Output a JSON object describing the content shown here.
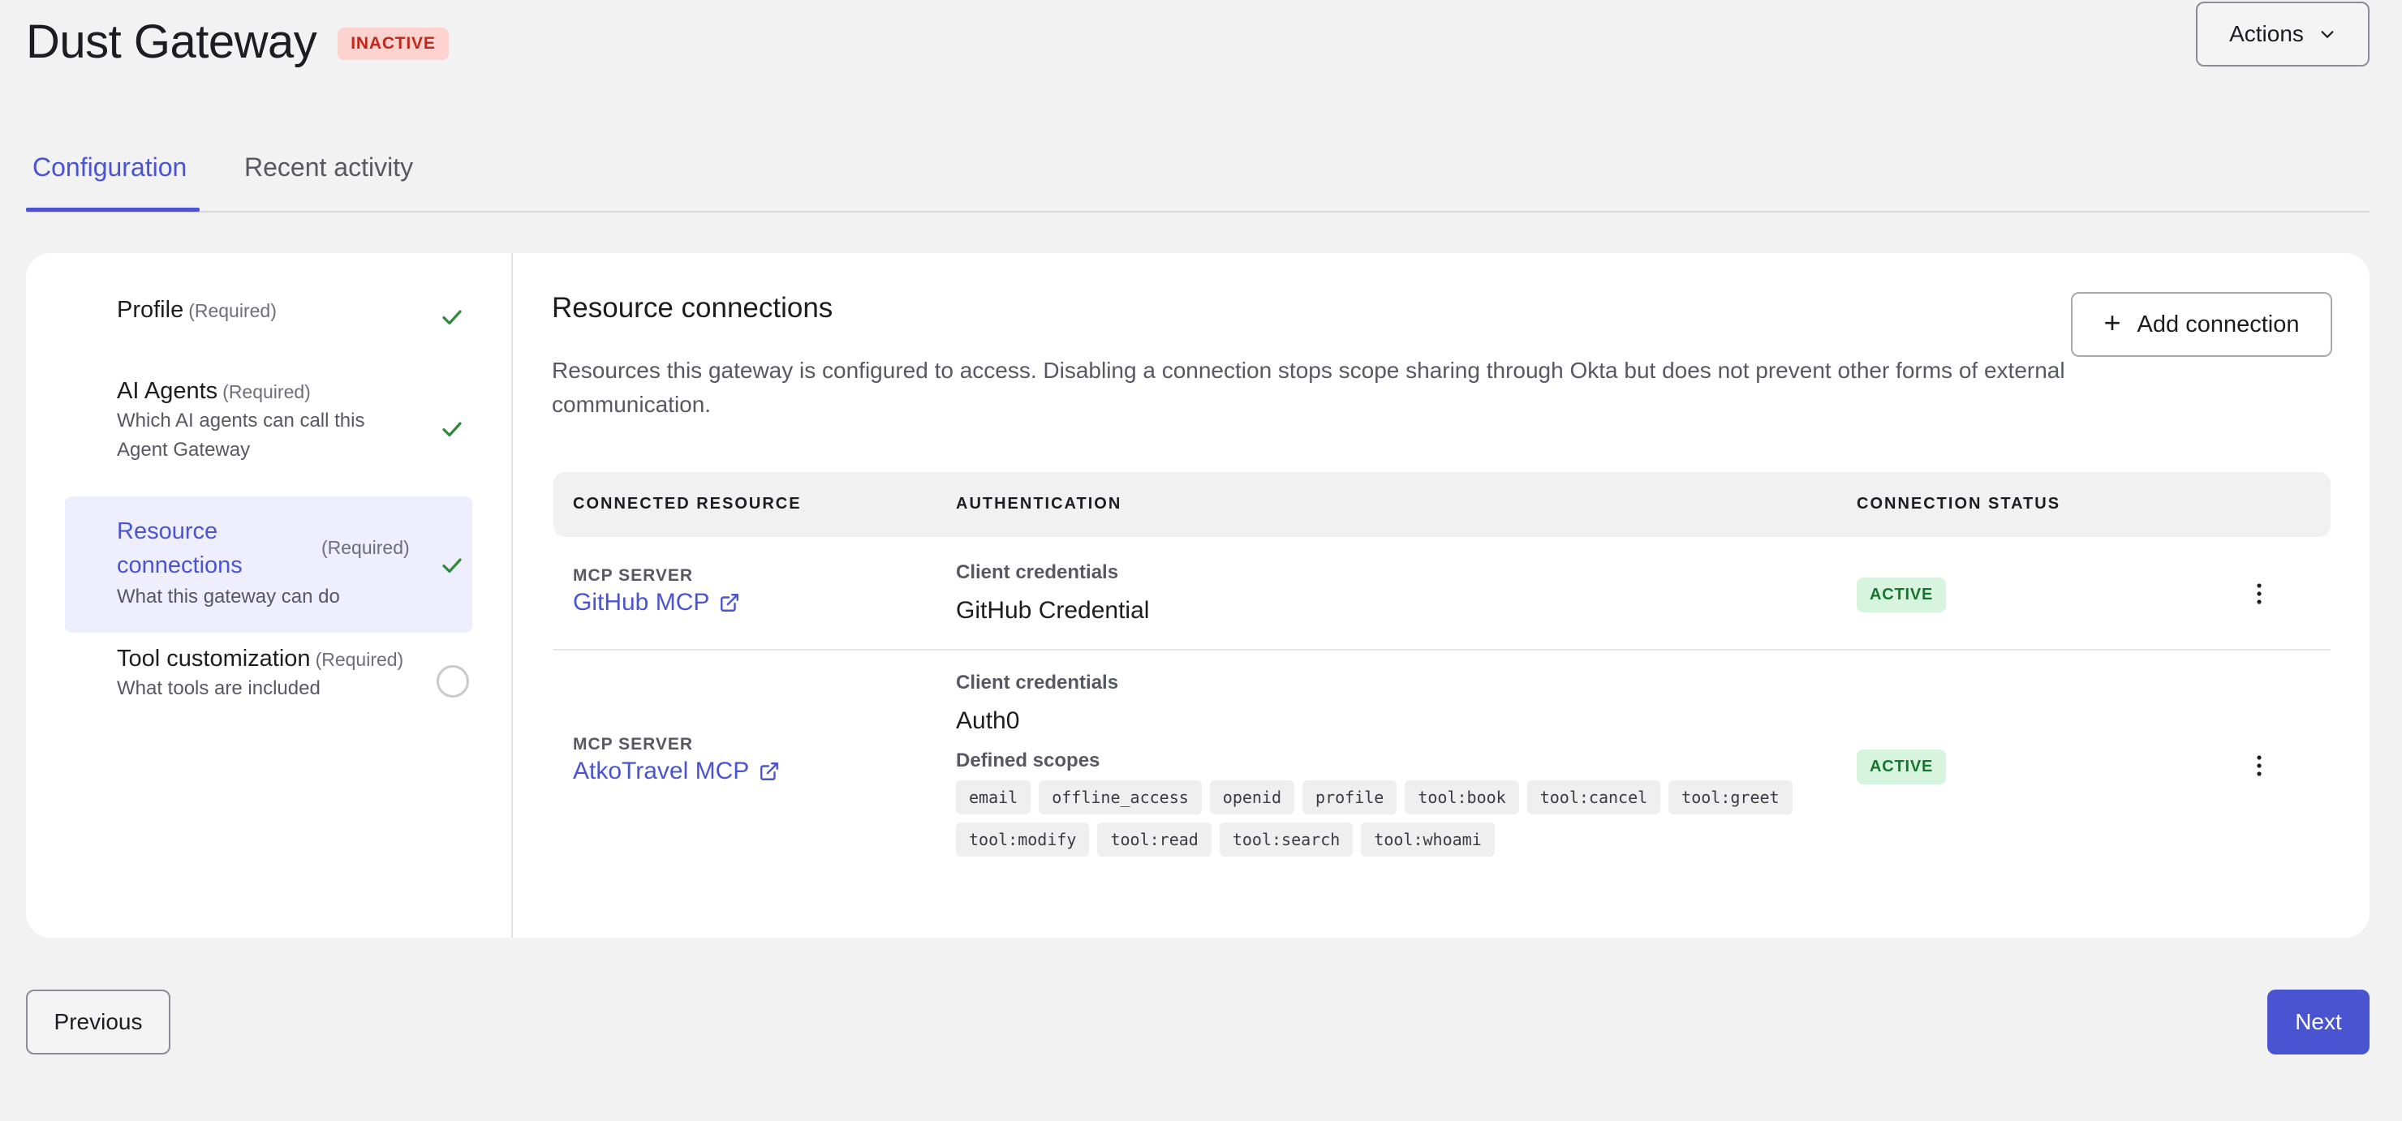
{
  "header": {
    "title": "Dust Gateway",
    "status": "INACTIVE",
    "actions_label": "Actions"
  },
  "tabs": [
    {
      "label": "Configuration",
      "active": true
    },
    {
      "label": "Recent activity",
      "active": false
    }
  ],
  "steps": [
    {
      "title": "Profile",
      "required": "(Required)",
      "description": "",
      "complete": true
    },
    {
      "title": "AI Agents",
      "required": "(Required)",
      "description": "Which AI agents can call this Agent Gateway",
      "complete": true
    },
    {
      "title": "Resource connections",
      "required": "(Required)",
      "description": "What this gateway can do",
      "complete": true,
      "selected": true
    },
    {
      "title": "Tool customization",
      "required": "(Required)",
      "description": "What tools are included",
      "complete": false
    }
  ],
  "section": {
    "title": "Resource connections",
    "description": "Resources this gateway is configured to access. Disabling a connection stops scope sharing through Okta but does not prevent other forms of external communication.",
    "add_label": "Add connection"
  },
  "table": {
    "headers": [
      "CONNECTED RESOURCE",
      "AUTHENTICATION",
      "CONNECTION STATUS"
    ],
    "rows": [
      {
        "type": "MCP SERVER",
        "name": "GitHub MCP",
        "auth_label": "Client credentials",
        "auth_value": "GitHub Credential",
        "status": "ACTIVE"
      },
      {
        "type": "MCP SERVER",
        "name": "AtkoTravel MCP",
        "auth_label": "Client credentials",
        "auth_value": "Auth0",
        "scopes_label": "Defined scopes",
        "scopes": [
          "email",
          "offline_access",
          "openid",
          "profile",
          "tool:book",
          "tool:cancel",
          "tool:greet",
          "tool:modify",
          "tool:read",
          "tool:search",
          "tool:whoami"
        ],
        "status": "ACTIVE"
      }
    ]
  },
  "footer": {
    "previous_label": "Previous",
    "next_label": "Next"
  },
  "colors": {
    "accent": "#4a54d1",
    "success": "#17752f",
    "danger": "#c0281b"
  }
}
